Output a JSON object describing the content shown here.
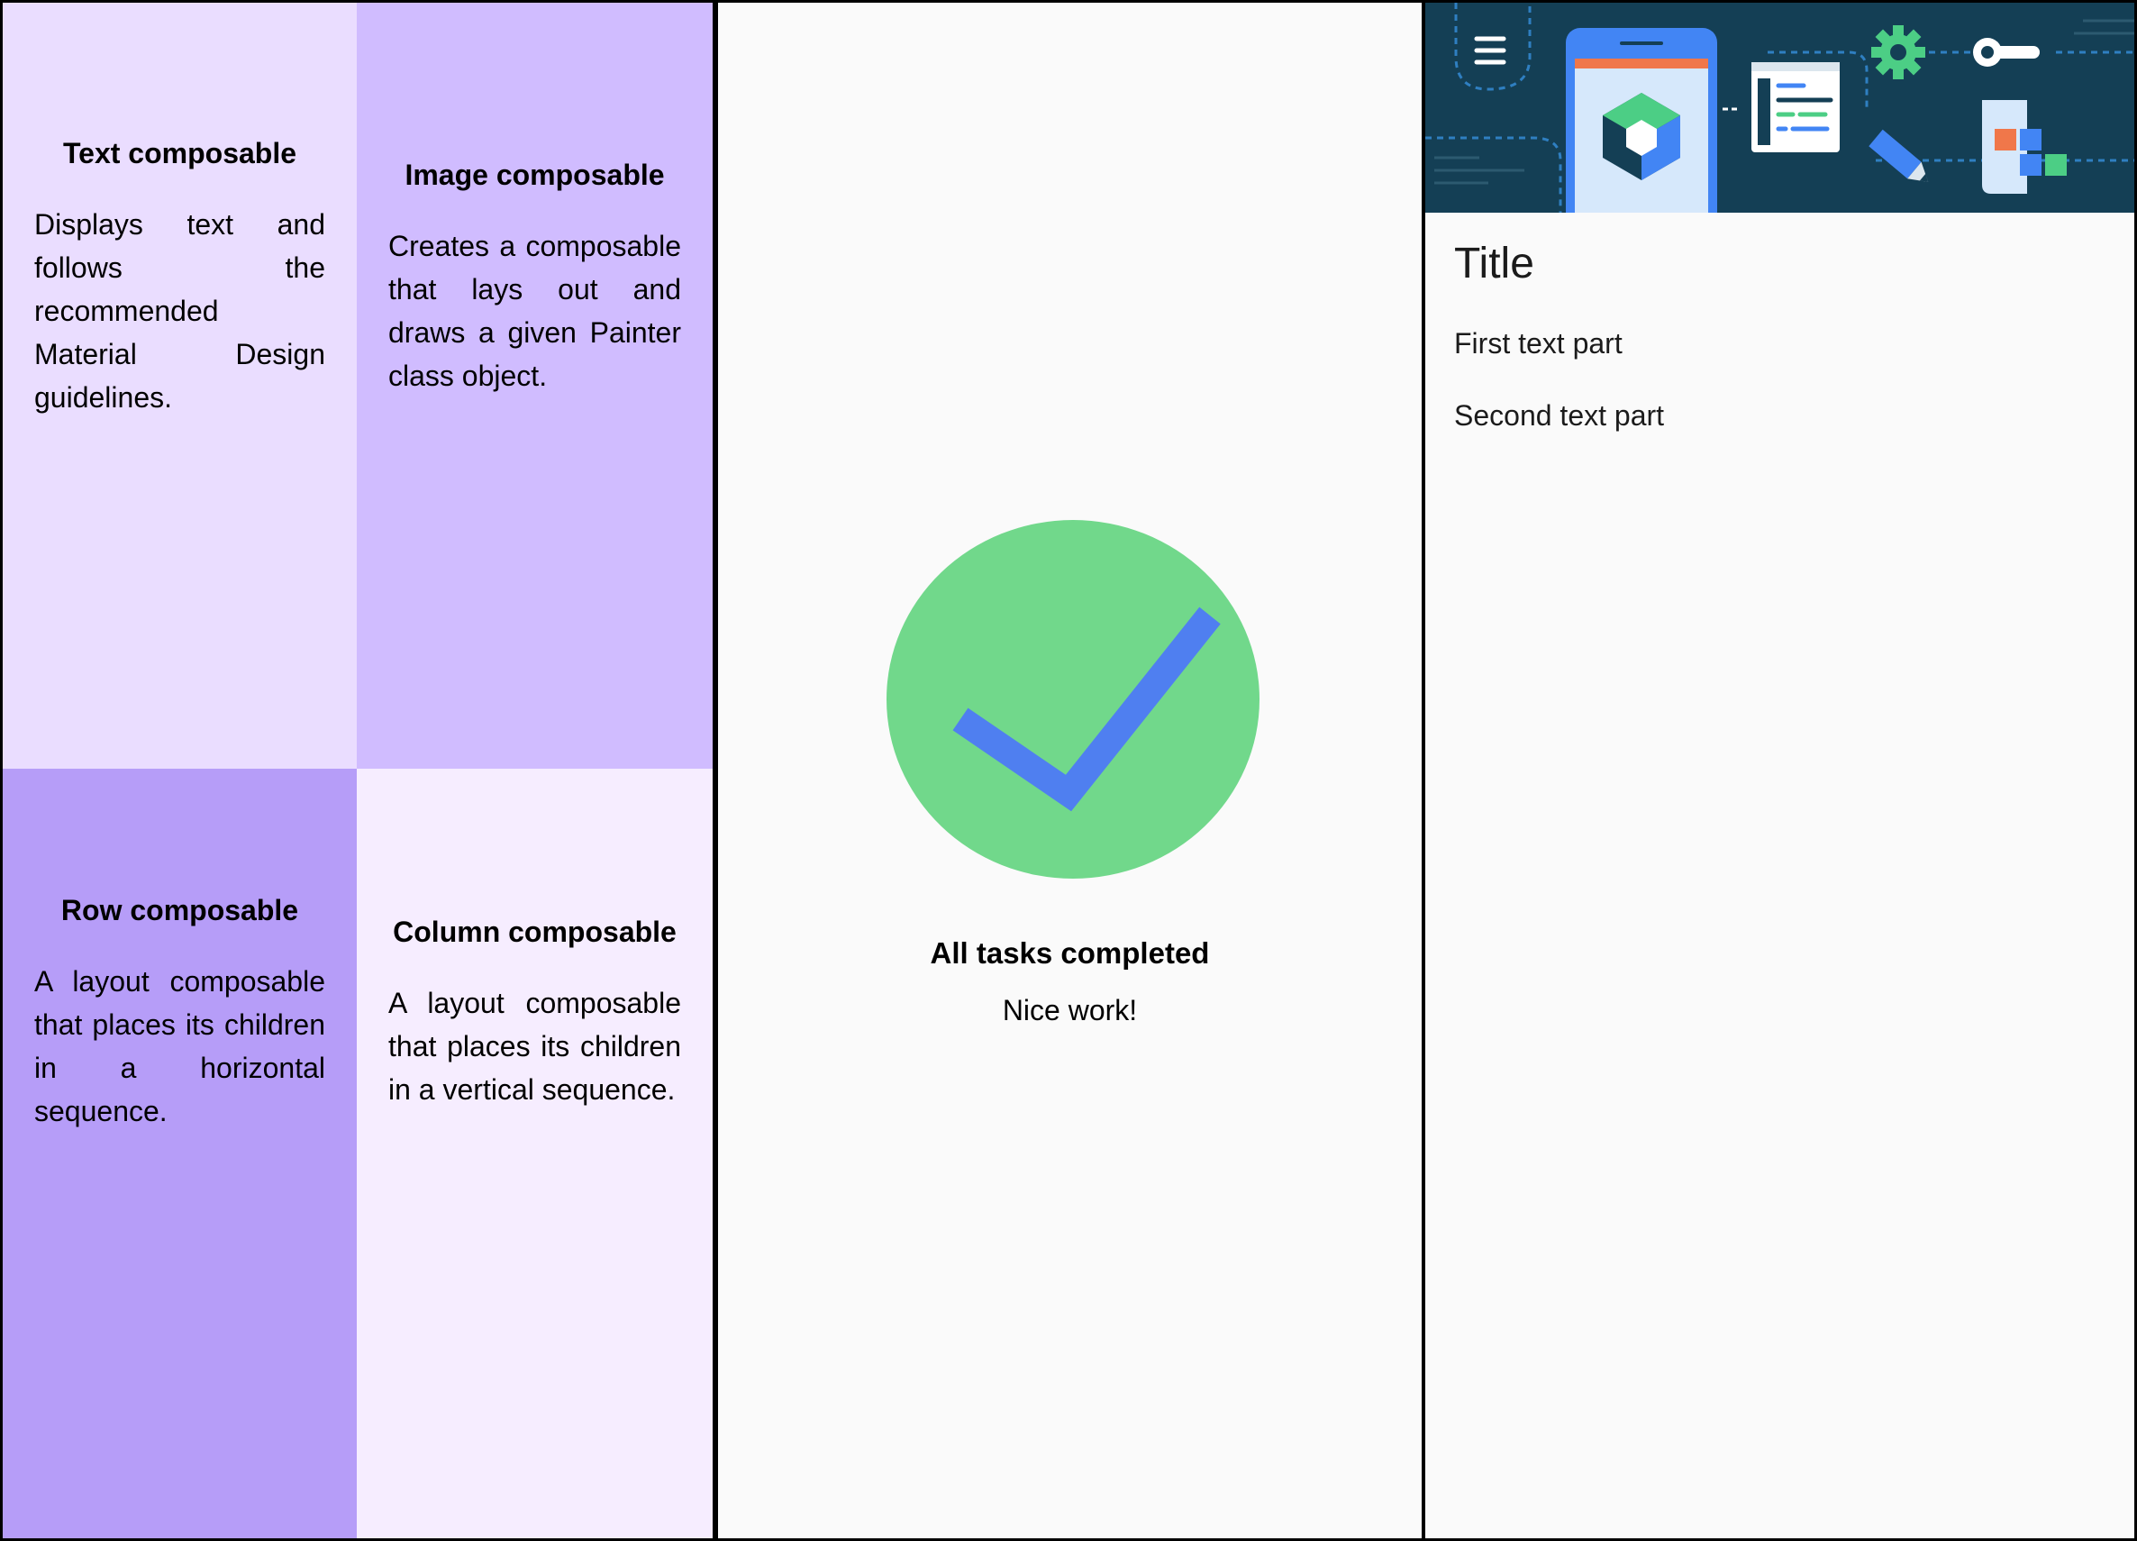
{
  "colors": {
    "quad_text": "#eaddff",
    "quad_image": "#d0bcff",
    "quad_row": "#b69df8",
    "quad_column": "#f6edff",
    "check_circle": "#71d88b",
    "check_mark": "#4f7ff0",
    "hero_background": "#143f55"
  },
  "quadrants": {
    "text": {
      "title": "Text composable",
      "body": "Displays text and follows the recommended Material Design guidelines."
    },
    "image": {
      "title": "Image composable",
      "body": "Creates a composable that lays out and draws a given Painter class object."
    },
    "row": {
      "title": "Row composable",
      "body": "A layout composable that places its children in a horizontal sequence."
    },
    "column": {
      "title": "Column composable",
      "body": "A layout composable that places its children in a vertical sequence."
    }
  },
  "task_manager": {
    "icon": "check-circle-icon",
    "title": "All tasks completed",
    "subtitle": "Nice work!"
  },
  "article": {
    "hero_icon": "compose-illustration",
    "title": "Title",
    "first_text": "First text part",
    "second_text": "Second text part"
  }
}
